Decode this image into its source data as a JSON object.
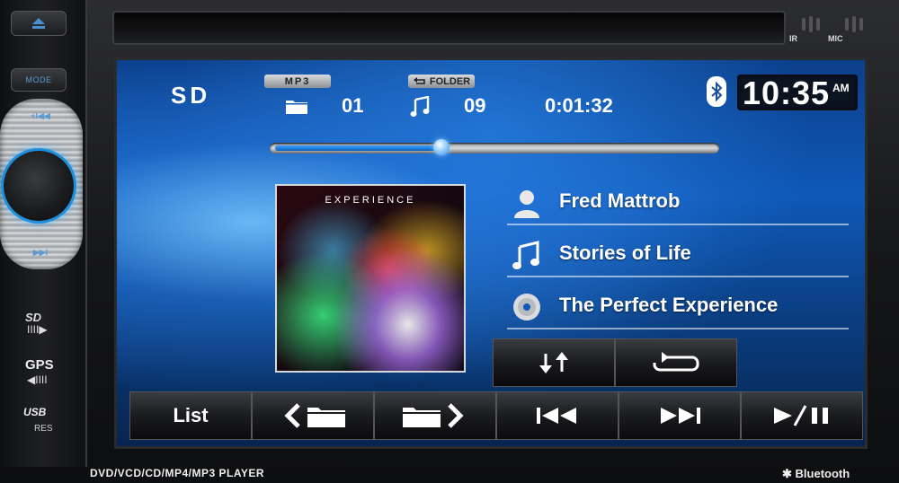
{
  "hardware": {
    "mode_label": "MODE",
    "knob_prev": "+I◀◀",
    "knob_next": "▶▶I",
    "ir_label": "IR",
    "mic_label": "MIC",
    "sd_label": "SD",
    "sd_arrow": "IIII▶",
    "gps_label": "GPS",
    "gps_arrow": "◀IIII",
    "usb_label": "USB",
    "res_label": "RES",
    "model_text": "DVD/VCD/CD/MP4/MP3 PLAYER",
    "bluetooth_text": "Bluetooth"
  },
  "status": {
    "source": "SD",
    "format_tag": "MP3",
    "repeat_tag": "FOLDER",
    "folder_number": "01",
    "track_number": "09",
    "elapsed_time": "0:01:32",
    "clock_time": "10:35",
    "clock_ampm": "AM"
  },
  "playback": {
    "progress_fraction": 0.38
  },
  "album": {
    "art_title": "EXPERIENCE"
  },
  "track_info": {
    "artist": "Fred Mattrob",
    "song": "Stories of Life",
    "album": "The Perfect Experience"
  },
  "controls": {
    "list_label": "List"
  },
  "icons": {
    "eject": "eject-icon",
    "folder": "folder-icon",
    "note": "music-note-icon",
    "bluetooth": "bluetooth-icon",
    "artist": "person-icon",
    "album": "disc-icon",
    "shuffle": "shuffle-arrows-icon",
    "repeat": "repeat-icon",
    "prev_folder": "prev-folder-icon",
    "next_folder": "next-folder-icon",
    "prev_track": "previous-track-icon",
    "next_track": "next-track-icon",
    "play_pause": "play-pause-icon"
  },
  "colors": {
    "accent_blue": "#2fa9ff",
    "screen_top": "#0b3f8a",
    "screen_mid": "#0f59b8"
  }
}
